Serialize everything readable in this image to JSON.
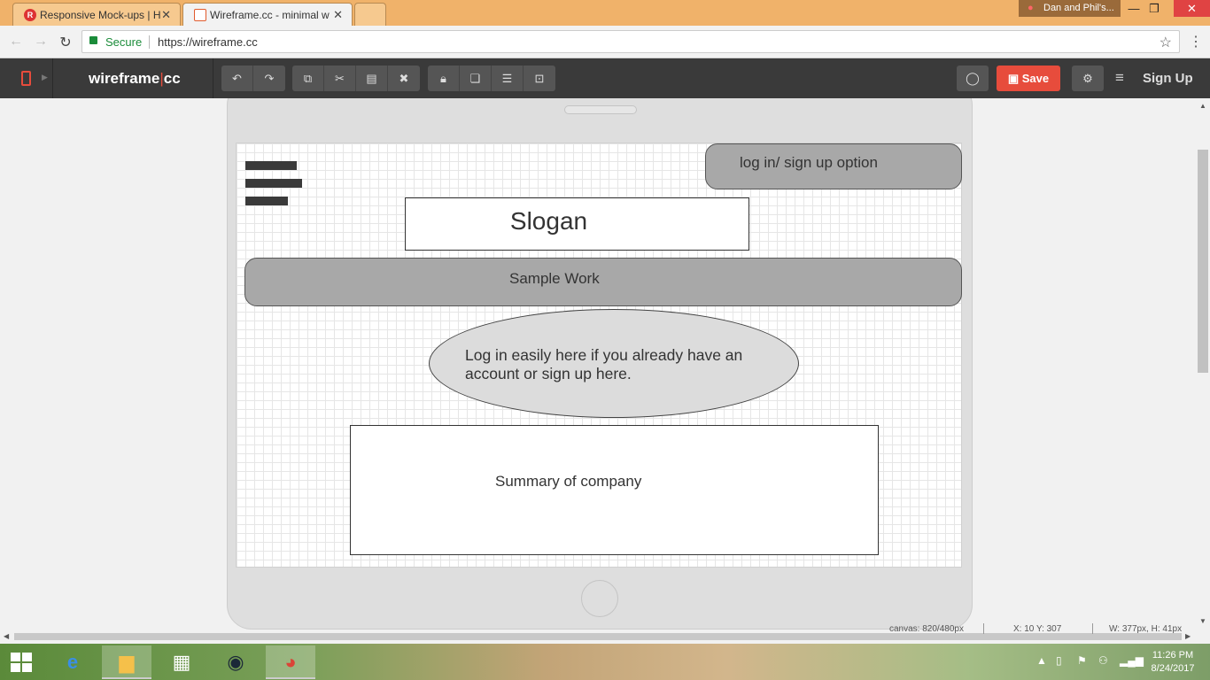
{
  "browser": {
    "tabs": [
      {
        "label": "Responsive Mock-ups | H",
        "favicon": "R"
      },
      {
        "label": "Wireframe.cc - minimal w",
        "favicon": ""
      }
    ],
    "profile_name": "Dan and Phil's...",
    "secure_label": "Secure",
    "url": "https://wireframe.cc"
  },
  "toolbar": {
    "logo_main": "wireframe",
    "logo_sep": "|",
    "logo_suffix": "cc",
    "save_label": "Save",
    "signup_label": "Sign Up",
    "accent_color": "#e74c3c"
  },
  "canvas": {
    "login_option": "log in/ sign up option",
    "slogan": "Slogan",
    "sample_work": "Sample Work",
    "login_prompt": "Log in easily here if you already have an account or sign up here.",
    "summary": "Summary of company"
  },
  "status": {
    "canvas_size": "canvas: 820/480px",
    "cursor": "X: 10 Y: 307",
    "selection": "W: 377px, H: 41px"
  },
  "taskbar": {
    "time": "11:26 PM",
    "date": "8/24/2017"
  }
}
